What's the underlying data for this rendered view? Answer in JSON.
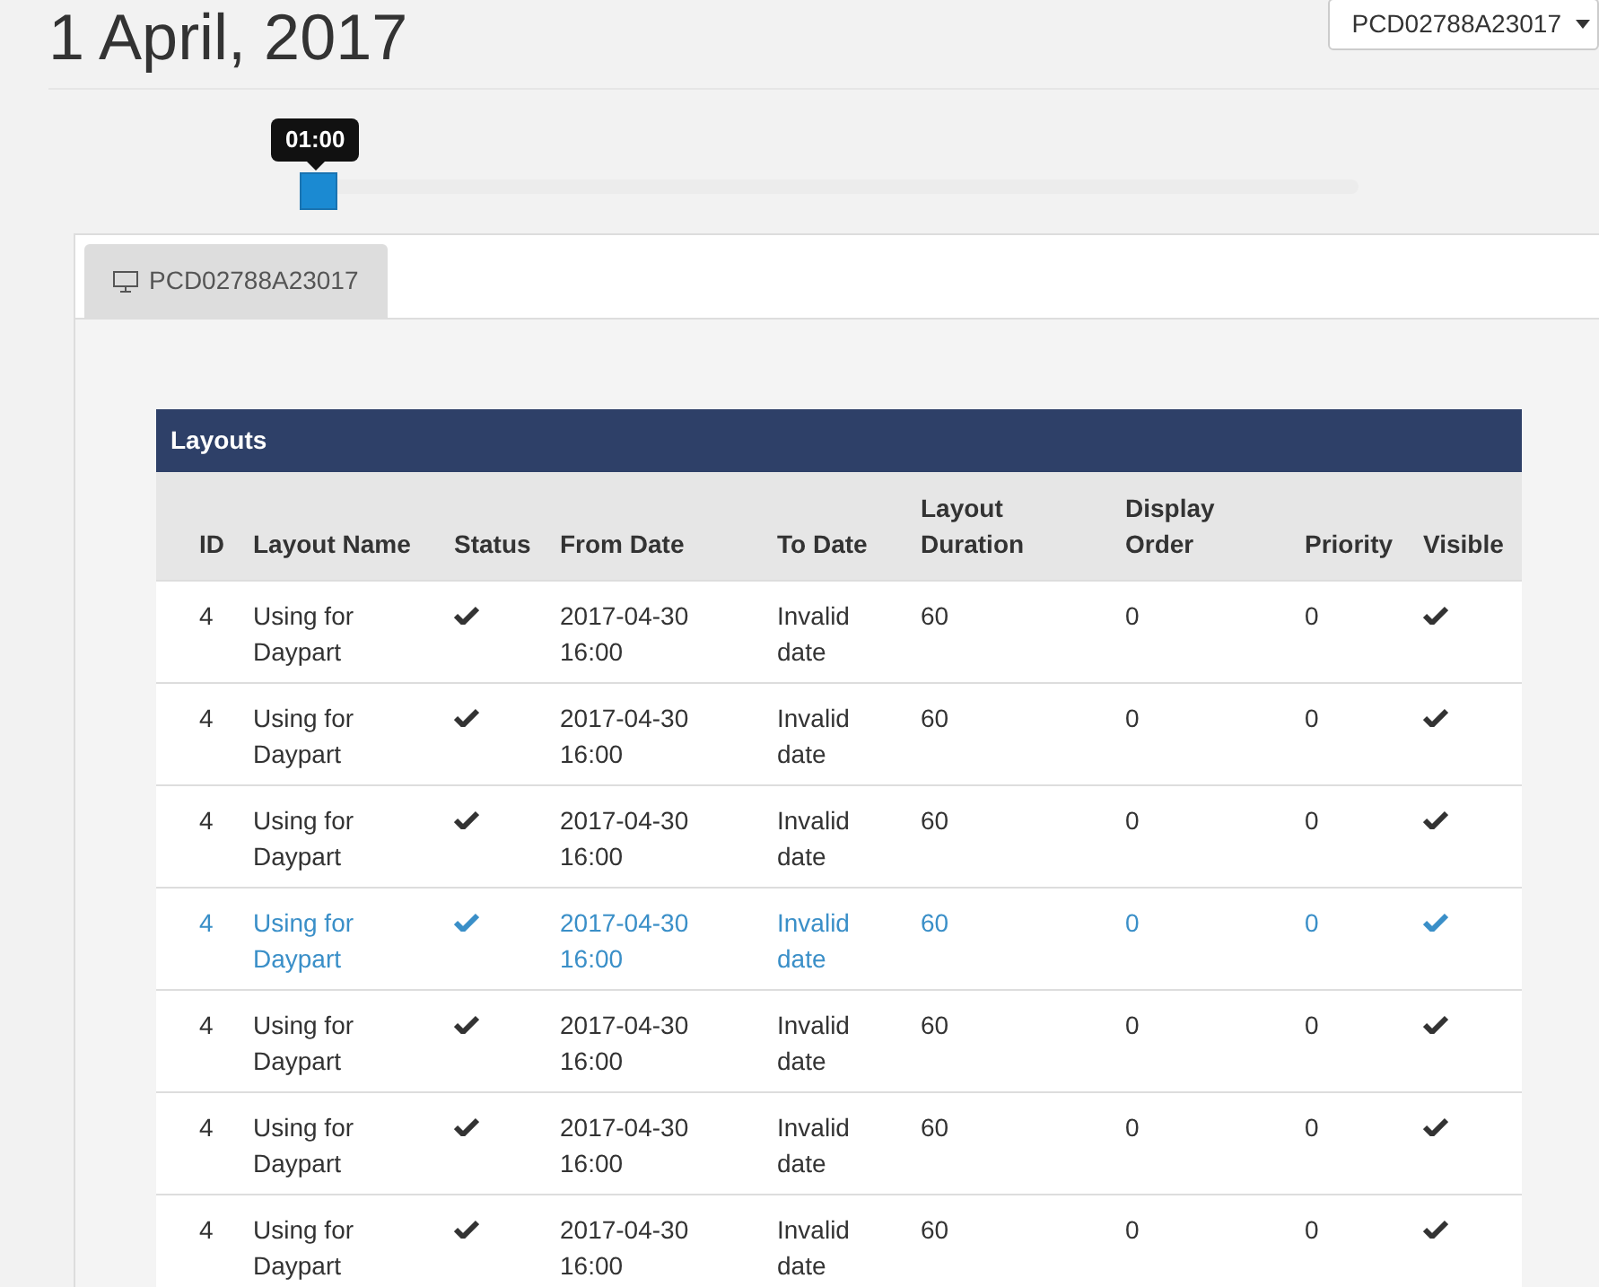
{
  "title": "1 April, 2017",
  "display_select": {
    "value": "PCD02788A23017"
  },
  "time_slider": {
    "tooltip": "01:00",
    "level": 0
  },
  "tabs": [
    {
      "label": "PCD02788A23017",
      "selected": true
    }
  ],
  "layouts": {
    "title": "Layouts",
    "columns": [
      "ID",
      "Layout Name",
      "Status",
      "From Date",
      "To Date",
      "Layout Duration",
      "Display Order",
      "Priority",
      "Visible"
    ],
    "rows": [
      {
        "id": "4",
        "name": "Using for Daypart",
        "status": true,
        "from": "2017-04-30 16:00",
        "to": "Invalid date",
        "duration": "60",
        "order": "0",
        "priority": "0",
        "visible": true,
        "selected": false
      },
      {
        "id": "4",
        "name": "Using for Daypart",
        "status": true,
        "from": "2017-04-30 16:00",
        "to": "Invalid date",
        "duration": "60",
        "order": "0",
        "priority": "0",
        "visible": true,
        "selected": false
      },
      {
        "id": "4",
        "name": "Using for Daypart",
        "status": true,
        "from": "2017-04-30 16:00",
        "to": "Invalid date",
        "duration": "60",
        "order": "0",
        "priority": "0",
        "visible": true,
        "selected": false
      },
      {
        "id": "4",
        "name": "Using for Daypart",
        "status": true,
        "from": "2017-04-30 16:00",
        "to": "Invalid date",
        "duration": "60",
        "order": "0",
        "priority": "0",
        "visible": true,
        "selected": true
      },
      {
        "id": "4",
        "name": "Using for Daypart",
        "status": true,
        "from": "2017-04-30 16:00",
        "to": "Invalid date",
        "duration": "60",
        "order": "0",
        "priority": "0",
        "visible": true,
        "selected": false
      },
      {
        "id": "4",
        "name": "Using for Daypart",
        "status": true,
        "from": "2017-04-30 16:00",
        "to": "Invalid date",
        "duration": "60",
        "order": "0",
        "priority": "0",
        "visible": true,
        "selected": false
      },
      {
        "id": "4",
        "name": "Using for Daypart",
        "status": true,
        "from": "2017-04-30 16:00",
        "to": "Invalid date",
        "duration": "60",
        "order": "0",
        "priority": "0",
        "visible": true,
        "selected": false
      }
    ]
  }
}
